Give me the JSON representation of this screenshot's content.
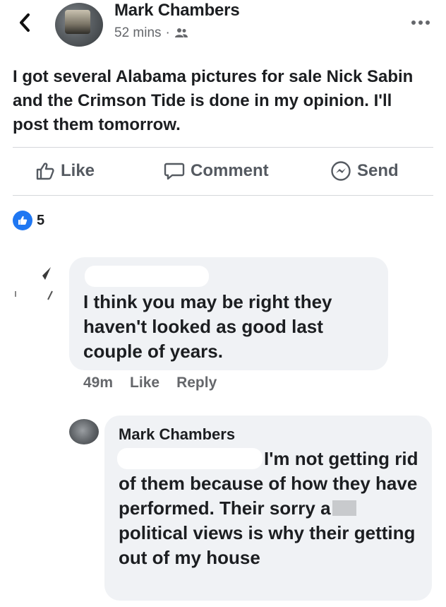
{
  "post": {
    "back_icon": "chevron-left-icon",
    "author": "Mark Chambers",
    "time": "52 mins",
    "separator": "·",
    "audience_icon": "friends-icon",
    "more_icon": "more-dots-icon",
    "text": "I got several Alabama pictures for sale  Nick Sabin and the Crimson Tide is done in my opinion. I'll post them tomorrow."
  },
  "actions": {
    "like": "Like",
    "comment": "Comment",
    "send": "Send"
  },
  "reactions": {
    "count": "5",
    "color": "#1f77f2"
  },
  "comments": [
    {
      "text": "I think you may be right they haven't looked as good last couple of years.",
      "time": "49m",
      "like": "Like",
      "reply": "Reply"
    }
  ],
  "reply": {
    "author": "Mark Chambers",
    "text_part1": "I'm not getting rid of them because of how they have performed. Their sorry a",
    "text_part2": " political views is why their getting out of my house"
  }
}
